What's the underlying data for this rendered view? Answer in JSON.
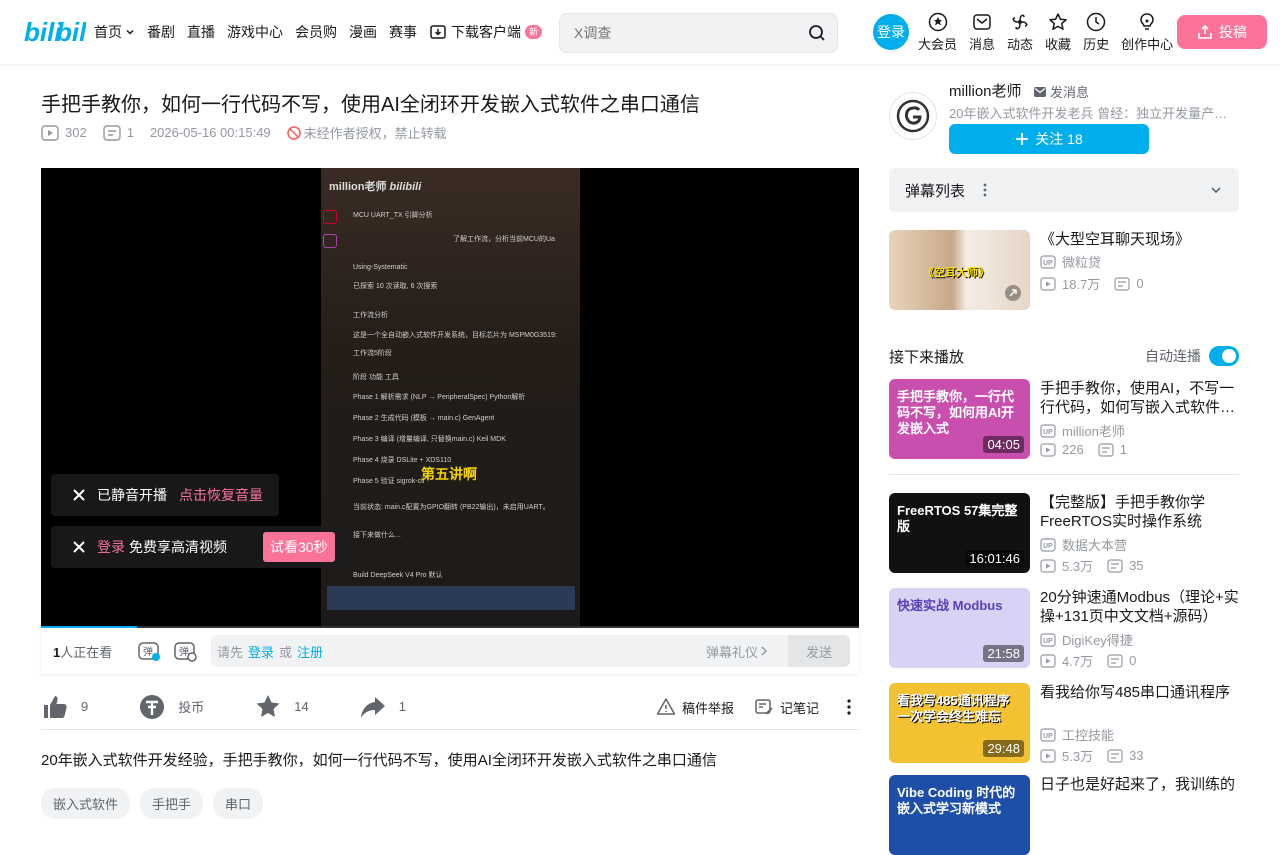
{
  "header": {
    "nav": [
      {
        "label": "首页",
        "dropdown": true
      },
      {
        "label": "番剧"
      },
      {
        "label": "直播"
      },
      {
        "label": "游戏中心"
      },
      {
        "label": "会员购"
      },
      {
        "label": "漫画"
      },
      {
        "label": "赛事"
      }
    ],
    "download_label": "下载客户端",
    "download_badge": "新",
    "search_placeholder": "X调查",
    "login_label": "登录",
    "icons": [
      {
        "label": "大会员",
        "icon": "vip-icon"
      },
      {
        "label": "消息",
        "icon": "message-icon"
      },
      {
        "label": "动态",
        "icon": "dynamic-icon"
      },
      {
        "label": "收藏",
        "icon": "favorite-icon"
      },
      {
        "label": "历史",
        "icon": "history-icon"
      },
      {
        "label": "创作中心",
        "icon": "creator-icon"
      }
    ],
    "upload_label": "投稿"
  },
  "video": {
    "title": "手把手教你，如何一行代码不写，使用AI全闭环开发嵌入式软件之串口通信",
    "views": "302",
    "danmaku_count": "1",
    "date": "2026-05-16 00:15:49",
    "copyright": "未经作者授权，禁止转载",
    "progress_fraction": 0.117
  },
  "player": {
    "muted_text": "已静音开播",
    "restore_text": "点击恢复音量",
    "login_link": "登录",
    "login_text": "免费享高清视频",
    "trial_label": "试看30秒",
    "watermark": "million老师",
    "subtitle": "第五讲啊",
    "screen_lines": [
      "MCU UART_TX 引脚分析",
      "了解工作流，分析当前MCU的Ua",
      "Using-Systematic",
      "已探索 10 次读取, 6 次搜索",
      "工作流分析",
      "这是一个全自动嵌入式软件开发系统，目标芯片为 MSPM0G3519:",
      "工作流5阶段",
      "阶段      功能                               工具",
      "Phase 1   解析需求 (NLP → PeripheralSpec)     Python解析",
      "Phase 2   生成代码 (模板 → main.c)            GenAgent",
      "Phase 3   编译 (增量编译, 只替换main.c)         Keil MDK",
      "Phase 4   烧录                               DSLite + XDS110",
      "Phase 5   验证                               sigrok-cli",
      "当前状态: main.c配置为GPIO翻转 (PB22输出)，未启用UART。",
      "接下来做什么...",
      "Build        DeepSeek V4 Pro        默认"
    ]
  },
  "danmaku_bar": {
    "watching_count": "1",
    "watching_suffix": "人正在看",
    "prompt_prefix": "请先",
    "login": "登录",
    "or": "或",
    "register": "注册",
    "etiquette": "弹幕礼仪",
    "send": "发送"
  },
  "actions": {
    "like": "9",
    "coin": "投币",
    "favorite": "14",
    "share": "1",
    "report": "稿件举报",
    "notes": "记笔记"
  },
  "description": "20年嵌入式软件开发经验，手把手教你，如何一行代码不写，使用AI全闭环开发嵌入式软件之串口通信",
  "tags": [
    "嵌入式软件",
    "手把手",
    "串口"
  ],
  "uploader": {
    "name": "million老师",
    "message": "发消息",
    "desc": "20年嵌入式软件开发老兵 曾经：独立开发量产…",
    "follow_label": "关注",
    "followers": "18"
  },
  "danmaku_list": {
    "label": "弹幕列表"
  },
  "ad_card": {
    "title": "《大型空耳聊天现场》",
    "uploader": "微粒贷",
    "views": "18.7万",
    "danmaku": "0",
    "thumb_text": "《空耳大师》"
  },
  "next_up": {
    "label": "接下来播放",
    "autoplay_label": "自动连播",
    "autoplay": true
  },
  "recommendations": [
    {
      "title": "手把手教你，使用AI，不写一行代码，如何写嵌入式软件…",
      "uploader": "million老师",
      "views": "226",
      "danmaku": "1",
      "duration": "04:05",
      "thumb_text": "手把手教你，一行代码不写，如何用AI开发嵌入式",
      "thumb_color": "#c94fae"
    },
    {
      "title": "【完整版】手把手教你学FreeRTOS实时操作系统",
      "uploader": "数据大本营",
      "views": "5.3万",
      "danmaku": "35",
      "duration": "16:01:46",
      "thumb_text": "FreeRTOS 57集完整版",
      "thumb_color": "#111111"
    },
    {
      "title": "20分钟速通Modbus（理论+实操+131页中文文档+源码）",
      "uploader": "DigiKey得捷",
      "views": "4.7万",
      "danmaku": "0",
      "duration": "21:58",
      "thumb_text": "快速实战 Modbus",
      "thumb_color": "#d8d2f5"
    },
    {
      "title": "看我给你写485串口通讯程序",
      "uploader": "工控技能",
      "views": "5.3万",
      "danmaku": "33",
      "duration": "29:48",
      "thumb_text": "看我写485通讯程序 一次学会终生难忘",
      "thumb_color": "#f2c232"
    },
    {
      "title": "日子也是好起来了，我训练的",
      "uploader": "",
      "views": "",
      "danmaku": "",
      "duration": "",
      "thumb_text": "Vibe Coding 时代的嵌入式学习新模式",
      "thumb_color": "#1d4ea8"
    }
  ]
}
